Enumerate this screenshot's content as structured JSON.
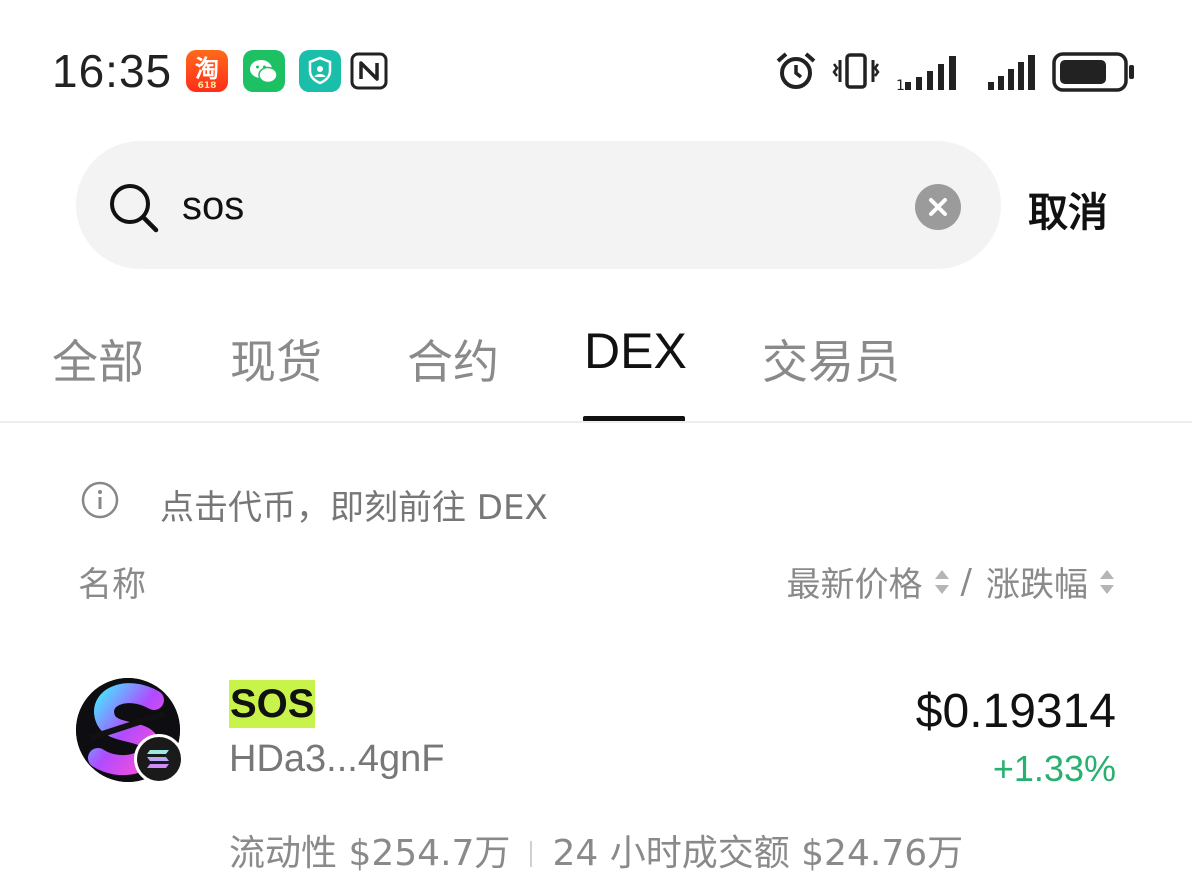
{
  "status_bar": {
    "time": "16:35",
    "taobao_icon_text": "淘",
    "taobao_icon_sub": "618",
    "icons": [
      "taobao-618-icon",
      "wechat-icon",
      "shield-app-icon",
      "nfc-icon",
      "alarm-icon",
      "vibrate-icon",
      "signal-1-icon",
      "signal-2-icon",
      "battery-icon"
    ]
  },
  "search": {
    "value": "sos",
    "placeholder": "",
    "cancel_label": "取消"
  },
  "tabs": [
    {
      "label": "全部",
      "active": false
    },
    {
      "label": "现货",
      "active": false
    },
    {
      "label": "合约",
      "active": false
    },
    {
      "label": "DEX",
      "active": true
    },
    {
      "label": "交易员",
      "active": false
    }
  ],
  "info": {
    "text": "点击代币，即刻前往 DEX"
  },
  "list_header": {
    "name": "名称",
    "price": "最新价格",
    "separator": "/",
    "change": "涨跌幅"
  },
  "tokens": [
    {
      "symbol": "SOS",
      "address": "HDa3...4gnF",
      "price": "$0.19314",
      "change": "+1.33%",
      "liquidity_label": "流动性",
      "liquidity": "$254.7万",
      "volume_label": "24 小时成交额",
      "volume": "$24.76万",
      "chain": "solana"
    }
  ],
  "colors": {
    "highlight": "#c8f34a",
    "positive": "#26b170",
    "tab_active": "#111111",
    "tab_inactive": "#8a8a8a"
  }
}
